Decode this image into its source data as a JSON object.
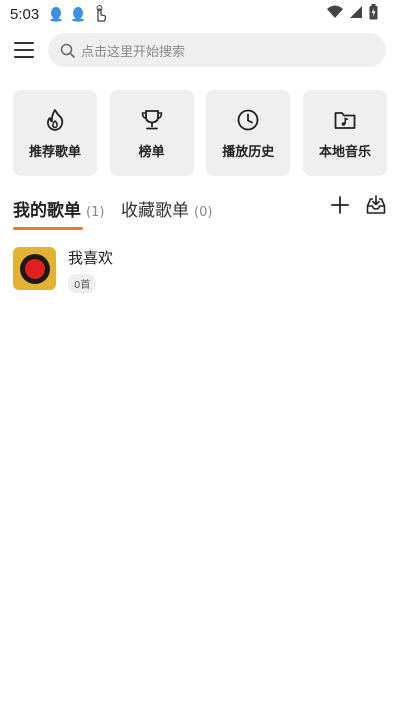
{
  "status_bar": {
    "time": "5:03",
    "left_icons": [
      "qq-icon",
      "qq-icon",
      "touch-hand-icon"
    ],
    "right_icons": [
      "wifi-icon",
      "signal-icon",
      "battery-charging-icon"
    ]
  },
  "top_bar": {
    "menu_icon": "hamburger-menu-icon",
    "search": {
      "icon": "search-icon",
      "placeholder": "点击这里开始搜索"
    }
  },
  "quick_actions": [
    {
      "icon": "flame-icon",
      "label": "推荐歌单"
    },
    {
      "icon": "trophy-icon",
      "label": "榜单"
    },
    {
      "icon": "clock-icon",
      "label": "播放历史"
    },
    {
      "icon": "music-folder-icon",
      "label": "本地音乐"
    }
  ],
  "tabs": {
    "mine": {
      "label": "我的歌单",
      "count": "(1)",
      "active": true
    },
    "collected": {
      "label": "收藏歌单",
      "count": "(0)",
      "active": false
    },
    "accent_color": "#f0782d",
    "actions": [
      "add-icon",
      "import-tray-icon"
    ]
  },
  "playlists": [
    {
      "name": "我喜欢",
      "count_label": "0首",
      "cover_icon": "apple-disc-icon"
    }
  ]
}
